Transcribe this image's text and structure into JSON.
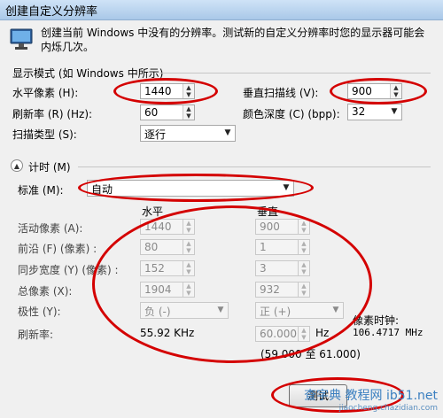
{
  "window": {
    "title": "创建自定义分辨率"
  },
  "description": "创建当前 Windows 中没有的分辨率。测试新的自定义分辨率时您的显示器可能会内烁几次。",
  "display_mode": {
    "group_title": "显示模式 (如 Windows 中所示)",
    "h_pixels_label": "水平像素 (H):",
    "h_pixels_value": "1440",
    "v_lines_label": "垂直扫描线 (V):",
    "v_lines_value": "900",
    "refresh_label": "刷新率 (R) (Hz):",
    "refresh_value": "60",
    "color_depth_label": "颜色深度 (C) (bpp):",
    "color_depth_value": "32",
    "scan_type_label": "扫描类型 (S):",
    "scan_type_value": "逐行"
  },
  "timing": {
    "section_title": "计时 (M)",
    "standard_label": "标准 (M):",
    "standard_value": "自动",
    "col_horizontal": "水平",
    "col_vertical": "垂直",
    "active_pixels_label": "活动像素 (A):",
    "active_h": "1440",
    "active_v": "900",
    "front_porch_label": "前沿 (F) (像素) :",
    "front_h": "80",
    "front_v": "1",
    "sync_width_label": "同步宽度 (Y) (像素) :",
    "sync_h": "152",
    "sync_v": "3",
    "total_pixels_label": "总像素 (X):",
    "total_h": "1904",
    "total_v": "932",
    "polarity_label": "极性 (Y):",
    "polarity_h": "负 (-)",
    "polarity_v": "正 (+)",
    "refresh_label": "刷新率:",
    "refresh_h": "55.92 KHz",
    "refresh_v": "60.000",
    "refresh_v_unit": "Hz",
    "refresh_range": "(59.000 至 61.000)",
    "pixel_clock_label": "像素时钟:",
    "pixel_clock_value": "106.4717 MHz"
  },
  "buttons": {
    "test_label": "测试"
  },
  "watermark": {
    "line1": "查字典 教程网 ib51.net",
    "line2": "jiaocheng.chazidian.com"
  },
  "colors": {
    "annotation": "#d40000"
  }
}
